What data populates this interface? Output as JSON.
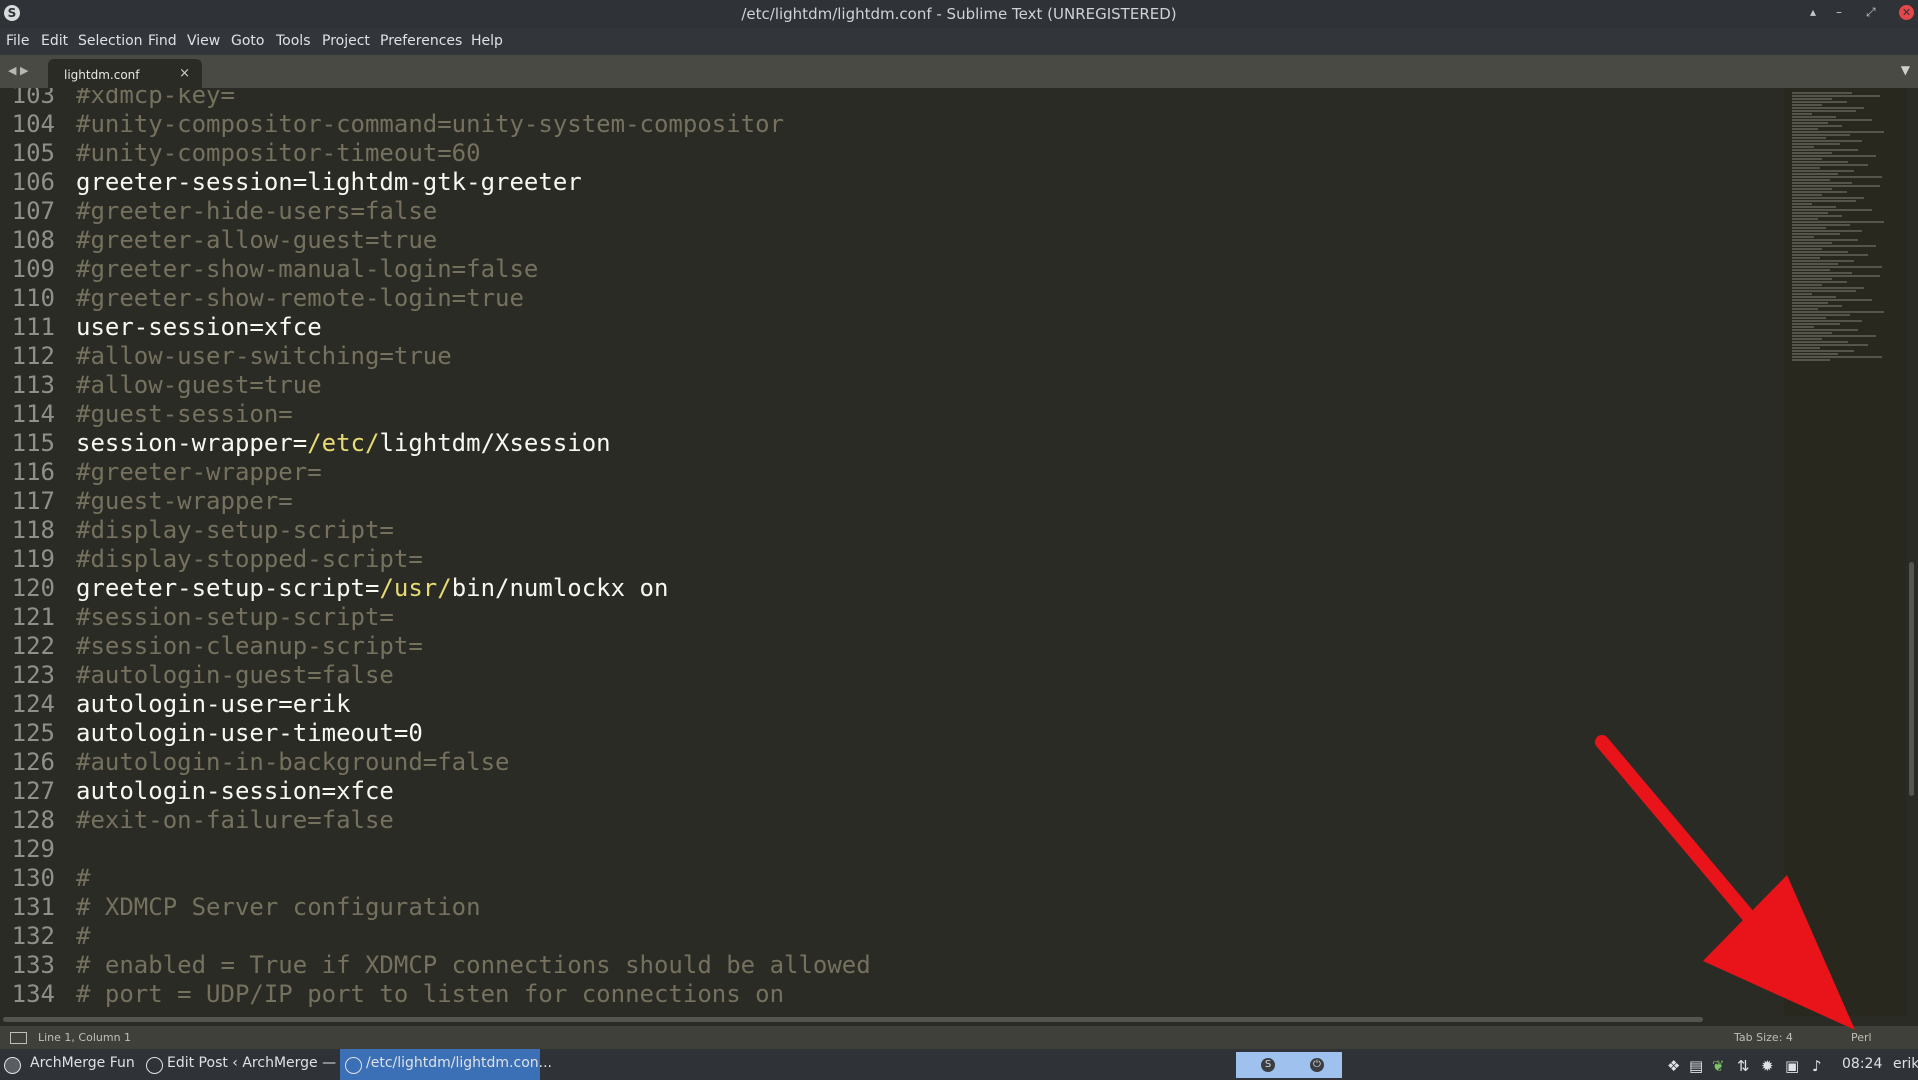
{
  "window": {
    "title": "/etc/lightdm/lightdm.conf - Sublime Text (UNREGISTERED)",
    "app_icon": "sublime-s-icon",
    "controls": [
      "▴",
      "–",
      "⤢",
      "✕"
    ]
  },
  "menubar": {
    "items": [
      "File",
      "Edit",
      "Selection",
      "Find",
      "View",
      "Goto",
      "Tools",
      "Project",
      "Preferences",
      "Help"
    ]
  },
  "tabs": {
    "nav": "◀ ▶",
    "active": {
      "label": "lightdm.conf",
      "close": "×"
    },
    "menu": "▼"
  },
  "editor": {
    "lines": [
      {
        "num": "103",
        "type": "comment",
        "text": "#xdmcp-key="
      },
      {
        "num": "104",
        "type": "comment",
        "text": "#unity-compositor-command=unity-system-compositor"
      },
      {
        "num": "105",
        "type": "comment",
        "text": "#unity-compositor-timeout=60"
      },
      {
        "num": "106",
        "type": "plain",
        "text": "greeter-session=lightdm-gtk-greeter"
      },
      {
        "num": "107",
        "type": "comment",
        "text": "#greeter-hide-users=false"
      },
      {
        "num": "108",
        "type": "comment",
        "text": "#greeter-allow-guest=true"
      },
      {
        "num": "109",
        "type": "comment",
        "text": "#greeter-show-manual-login=false"
      },
      {
        "num": "110",
        "type": "comment",
        "text": "#greeter-show-remote-login=true"
      },
      {
        "num": "111",
        "type": "plain",
        "text": "user-session=xfce"
      },
      {
        "num": "112",
        "type": "comment",
        "text": "#allow-user-switching=true"
      },
      {
        "num": "113",
        "type": "comment",
        "text": "#allow-guest=true"
      },
      {
        "num": "114",
        "type": "comment",
        "text": "#guest-session="
      },
      {
        "num": "115",
        "type": "path",
        "key": "session-wrapper=",
        "p1": "/etc/",
        "rest": "lightdm/Xsession"
      },
      {
        "num": "116",
        "type": "comment",
        "text": "#greeter-wrapper="
      },
      {
        "num": "117",
        "type": "comment",
        "text": "#guest-wrapper="
      },
      {
        "num": "118",
        "type": "comment",
        "text": "#display-setup-script="
      },
      {
        "num": "119",
        "type": "comment",
        "text": "#display-stopped-script="
      },
      {
        "num": "120",
        "type": "path",
        "key": "greeter-setup-script=",
        "p1": "/usr/",
        "rest": "bin/numlockx on"
      },
      {
        "num": "121",
        "type": "comment",
        "text": "#session-setup-script="
      },
      {
        "num": "122",
        "type": "comment",
        "text": "#session-cleanup-script="
      },
      {
        "num": "123",
        "type": "comment",
        "text": "#autologin-guest=false"
      },
      {
        "num": "124",
        "type": "plain",
        "text": "autologin-user=erik"
      },
      {
        "num": "125",
        "type": "plain",
        "text": "autologin-user-timeout=0"
      },
      {
        "num": "126",
        "type": "comment",
        "text": "#autologin-in-background=false"
      },
      {
        "num": "127",
        "type": "plain",
        "text": "autologin-session=xfce"
      },
      {
        "num": "128",
        "type": "comment",
        "text": "#exit-on-failure=false"
      },
      {
        "num": "129",
        "type": "plain",
        "text": ""
      },
      {
        "num": "130",
        "type": "comment",
        "text": "#"
      },
      {
        "num": "131",
        "type": "comment",
        "text": "# XDMCP Server configuration"
      },
      {
        "num": "132",
        "type": "comment",
        "text": "#"
      },
      {
        "num": "133",
        "type": "comment",
        "text": "# enabled = True if XDMCP connections should be allowed"
      },
      {
        "num": "134",
        "type": "comment",
        "text": "# port = UDP/IP port to listen for connections on"
      }
    ]
  },
  "statusbar": {
    "position": "Line 1, Column 1",
    "tab_size": "Tab Size: 4",
    "syntax": "Perl"
  },
  "taskbar": {
    "items": [
      {
        "label": "ArchMerge Fun",
        "icon": "archmerge-logo-icon"
      },
      {
        "label": "Edit Post ‹ ArchMerge — ...",
        "icon": "browser-icon"
      },
      {
        "label": "/etc/lightdm/lightdm.con...",
        "icon": "sublime-s-icon"
      }
    ],
    "clock": "08:24",
    "user": "erik",
    "tray_icons": [
      "dropbox-icon",
      "clipboard-icon",
      "leaf-icon",
      "network-icon",
      "settings-icon",
      "screenshot-icon",
      "volume-icon"
    ]
  },
  "colors": {
    "comment": "#75715e",
    "text": "#f8f8f2",
    "path": "#e6db74",
    "annotation_arrow": "#e8141a"
  }
}
